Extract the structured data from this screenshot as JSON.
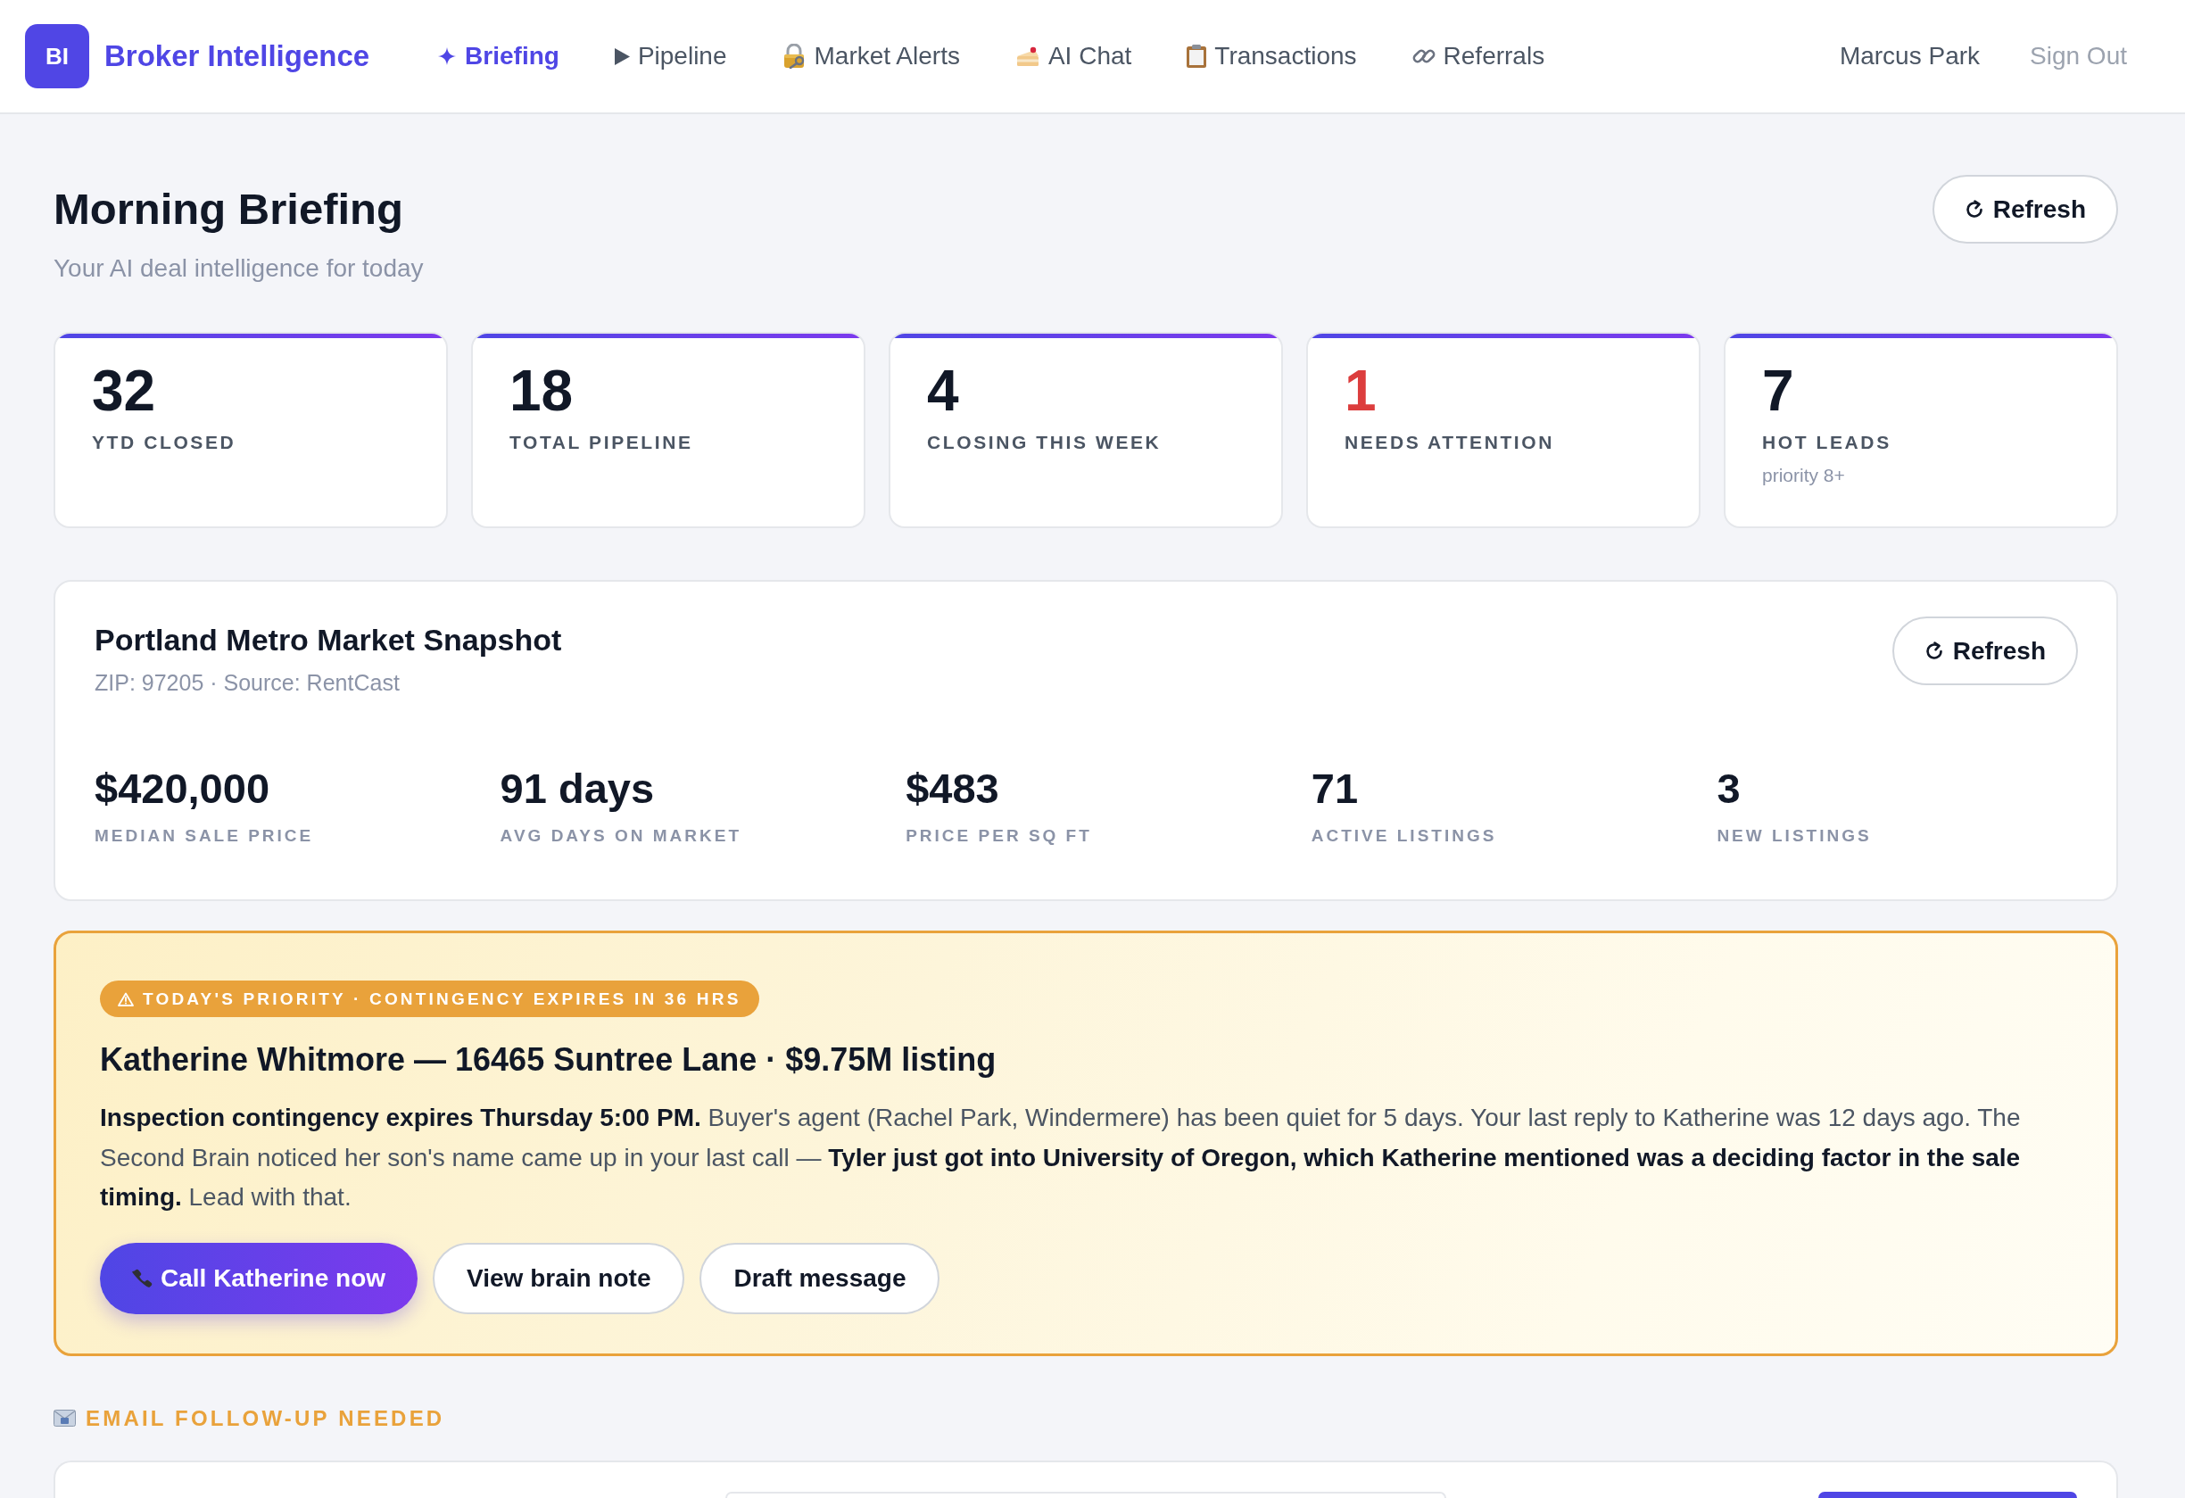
{
  "nav": {
    "logo": {
      "mark": "BI",
      "name": "Broker Intelligence"
    },
    "items": [
      {
        "label": "Briefing",
        "selected": true
      },
      {
        "label": "Pipeline",
        "selected": false
      },
      {
        "label": "Market Alerts",
        "selected": false
      },
      {
        "label": "AI Chat",
        "selected": false
      },
      {
        "label": "Transactions",
        "selected": false
      },
      {
        "label": "Referrals",
        "selected": false
      }
    ],
    "user": "Marcus Park",
    "sign_out": "Sign Out"
  },
  "header": {
    "title": "Morning Briefing",
    "subtitle": "Your AI deal intelligence for today",
    "refresh": "Refresh"
  },
  "stats": [
    {
      "value": "32",
      "label": "YTD CLOSED",
      "alert": false
    },
    {
      "value": "18",
      "label": "TOTAL PIPELINE",
      "alert": false
    },
    {
      "value": "4",
      "label": "CLOSING THIS WEEK",
      "alert": false
    },
    {
      "value": "1",
      "label": "NEEDS ATTENTION",
      "alert": true
    },
    {
      "value": "7",
      "label": "HOT LEADS",
      "note": "priority 8+",
      "alert": false
    }
  ],
  "market": {
    "title": "Portland Metro Market Snapshot",
    "subtitle": "ZIP: 97205 · Source: RentCast",
    "refresh": "Refresh",
    "metrics": [
      {
        "value": "$420,000",
        "label": "MEDIAN SALE PRICE"
      },
      {
        "value": "91 days",
        "label": "AVG DAYS ON MARKET"
      },
      {
        "value": "$483",
        "label": "PRICE PER SQ FT"
      },
      {
        "value": "71",
        "label": "ACTIVE LISTINGS"
      },
      {
        "value": "3",
        "label": "NEW LISTINGS"
      }
    ]
  },
  "priority": {
    "badge": "TODAY'S PRIORITY · CONTINGENCY EXPIRES IN 36 HRS",
    "title": "Katherine Whitmore — 16465 Suntree Lane · $9.75M listing",
    "body": "**Inspection contingency expires Thursday 5:00 PM.** Buyer's agent (Rachel Park, Windermere) has been quiet for 5 days. Your last reply to Katherine was 12 days ago. The Second Brain noticed her son's name came up in your last call — **Tyler just got into University of Oregon, which Katherine mentioned was a deciding factor in the sale timing.** Lead with that.",
    "actions": [
      {
        "label": "Call Katherine now",
        "kind": "primary"
      },
      {
        "label": "View brain note",
        "kind": "secondary"
      },
      {
        "label": "Draft message",
        "kind": "secondary"
      }
    ]
  },
  "email_followup": {
    "heading": "EMAIL FOLLOW-UP NEEDED"
  }
}
